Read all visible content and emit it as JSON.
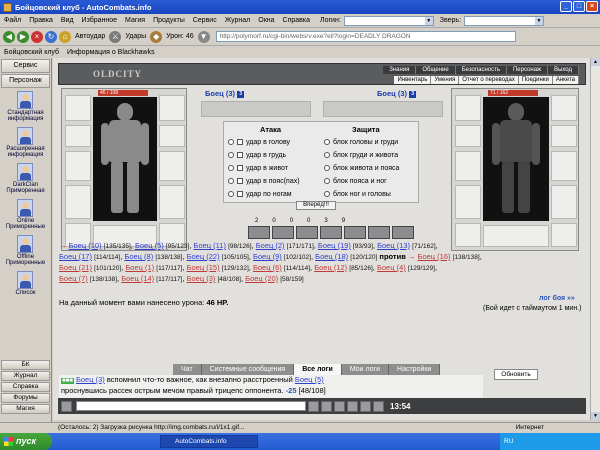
{
  "window": {
    "title": "Бойцовский клуб - AutoCombats.info"
  },
  "menu": {
    "items": [
      "Файл",
      "Правка",
      "Вид",
      "Избранное",
      "Магия",
      "Продукты",
      "Сервис",
      "Журнал",
      "Окна",
      "Справка"
    ],
    "login_label": "Логин:",
    "beast_label": "Зверь:"
  },
  "toolbar": {
    "autoattack_label": "Автоудар",
    "hits_label": "Удары",
    "damage_label": "Урон: 46",
    "address": "http://polymorf.ru/cgi-bin/websrv.exe?ell?login=DEADLY DRAGON"
  },
  "tabs": {
    "left": "Бойцовский клуб",
    "right": "Информация о Blackhawks"
  },
  "sidebar": {
    "top_buttons": [
      "Сервис",
      "Персонаж"
    ],
    "items": [
      "Стандартная информация",
      "Расширенная информация",
      "DarkClan Приморенная",
      "Online Приморенные",
      "Offline Приморенные",
      "Список"
    ],
    "bottom_buttons": [
      "БК",
      "Журнал",
      "Справка",
      "Форумы",
      "Магия"
    ]
  },
  "game": {
    "logo": "OLDCITY",
    "topnav": [
      "Знания",
      "Общение",
      "Безопасность",
      "Персонаж",
      "Выход"
    ],
    "subnav": [
      "Инвентарь",
      "Умения",
      "Отчет о переводах",
      "Поединки",
      "Анкета"
    ],
    "left_fighter": {
      "name": "Боец (3)",
      "level": "3",
      "hp": "46 / 108"
    },
    "right_fighter": {
      "name": "Боец (3)",
      "level": "3",
      "hp": "71 / 162"
    },
    "attack_header": "Атака",
    "defense_header": "Защита",
    "attacks": [
      "удар в голову",
      "удар в грудь",
      "удар в живот",
      "удар в пояс(пах)",
      "удар по ногам"
    ],
    "defenses": [
      "блок головы и груди",
      "блок груди и живота",
      "блок живота и пояса",
      "блок пояса и ног",
      "блок ног и головы"
    ],
    "forward_button": "Вперёд!!!",
    "ability_counts": [
      "2",
      "0",
      "0",
      "0",
      "3",
      "9"
    ],
    "roster_line1": [
      {
        "name": "Боец (10)",
        "hp": "[135/135]"
      },
      {
        "name": "Боец (5)",
        "hp": "[95/123]"
      },
      {
        "name": "Боец (11)",
        "hp": "[98/126]"
      },
      {
        "name": "Боец (2)",
        "hp": "[171/171]"
      },
      {
        "name": "Боец (19)",
        "hp": "[93/93]"
      },
      {
        "name": "Боец (13)",
        "hp": "[71/162]"
      }
    ],
    "roster_line2": [
      {
        "name": "Боец (17)",
        "hp": "[114/114]"
      },
      {
        "name": "Боец (8)",
        "hp": "[138/138]"
      },
      {
        "name": "Боец (22)",
        "hp": "[105/105]"
      },
      {
        "name": "Боец (9)",
        "hp": "[102/102]"
      },
      {
        "name": "Боец (18)",
        "hp": "[120/120]"
      }
    ],
    "versus": "против",
    "roster_line2_red": {
      "name": "Боец (16)",
      "hp": "[138/138]"
    },
    "roster_line3_red": [
      {
        "name": "Боец (21)",
        "hp": "[101/120]"
      },
      {
        "name": "Боец (1)",
        "hp": "[117/117]"
      },
      {
        "name": "Боец (15)",
        "hp": "[129/132]"
      },
      {
        "name": "Боец (6)",
        "hp": "[114/114]"
      },
      {
        "name": "Боец (12)",
        "hp": "[85/126]"
      },
      {
        "name": "Боец (4)",
        "hp": "[129/129]"
      },
      {
        "name": "Боец (7)",
        "hp": "[138/138]"
      },
      {
        "name": "Боец (14)",
        "hp": "[117/117]"
      },
      {
        "name": "Боец (3)",
        "hp": "[48/108]"
      },
      {
        "name": "Боец (20)",
        "hp": "[58/159]"
      }
    ],
    "damage_text": "На данный момент вами нанесено урона:",
    "damage_value": "46 HP.",
    "log_link": "лог боя »»",
    "timeout_text": "(Бой идет с таймаутом 1 мин.)"
  },
  "log": {
    "tabs": [
      "Чат",
      "Системные сообщения",
      "Все логи",
      "Мои логи",
      "Настройки"
    ],
    "active_tab": "Все логи",
    "refresh_button": "Обновить",
    "entry": {
      "actor": "Боец (3)",
      "text1": "вспомнил что-то важное, как внезапно расстроенный",
      "target": "Боец (5)",
      "text2": "проснувшись рассек острым мечом правый трицепс оппонента.",
      "damage": "-25",
      "hp": "[48/108]"
    },
    "clock": "13:54"
  },
  "statusbar": {
    "text": "(Осталось: 2) Загрузка рисунка http://img.combats.ru/i/1x1.gif...",
    "zone": "Интернет"
  },
  "taskbar": {
    "start": "пуск",
    "task": "AutoCombats.info",
    "tray": "RU"
  }
}
